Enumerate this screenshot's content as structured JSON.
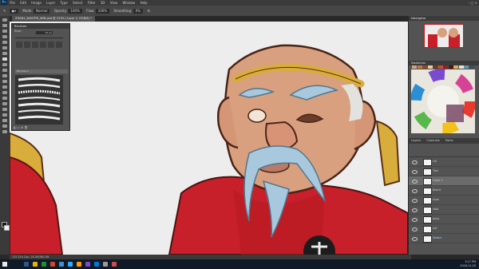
{
  "menubar": {
    "logo": "Ps",
    "items": [
      "File",
      "Edit",
      "Image",
      "Layer",
      "Type",
      "Select",
      "Filter",
      "3D",
      "View",
      "Window",
      "Help"
    ],
    "window_controls": "–  □  ×"
  },
  "options": {
    "mode_label": "Mode:",
    "mode_value": "Normal",
    "opacity_label": "Opacity:",
    "opacity_value": "100%",
    "flow_label": "Flow:",
    "flow_value": "100%",
    "smoothing_label": "Smoothing:",
    "smoothing_value": "0%"
  },
  "document": {
    "tab_title": "ZHAN1_MASTER_WIN.psd @ 133% (Layer 2, RGB/8) *",
    "status": "133.33%    Doc: 28.3M/360.0M"
  },
  "brushes_panel": {
    "title": "Brushes",
    "size_label": "Size:",
    "size_value": "45 px",
    "group_name": "Brushes 1",
    "footer": "◧  ▭  ⊞  🗑"
  },
  "navigator": {
    "title": "Navigator"
  },
  "swatches": {
    "title": "Swatches",
    "colors": [
      "#d0a383",
      "#b9784e",
      "#8a4c2d",
      "#ebc9a6",
      "#6f3a28",
      "#c94a3a",
      "#9a1d1d",
      "#5a1111",
      "#d7b25e",
      "#e6e2d3",
      "#6f8fa6",
      "#3e4d5e"
    ]
  },
  "layers_panel": {
    "tabs": [
      "Layers",
      "Channels",
      "Paths"
    ],
    "layers": [
      {
        "name": "sid",
        "active": false,
        "blue": false
      },
      {
        "name": "Tips",
        "active": false,
        "blue": false
      },
      {
        "name": "Layer 2",
        "active": true,
        "blue": false
      },
      {
        "name": "Beard",
        "active": false,
        "blue": false
      },
      {
        "name": "eyes",
        "active": false,
        "blue": false
      },
      {
        "name": "stab",
        "active": false,
        "blue": false
      },
      {
        "name": "body",
        "active": false,
        "blue": false
      },
      {
        "name": "hat",
        "active": false,
        "blue": false
      },
      {
        "name": "Sketch",
        "active": false,
        "blue": true
      }
    ]
  },
  "taskbar": {
    "time": "3:17 PM",
    "date": "2018-11-20",
    "icon_colors": [
      "#2b5797",
      "#e8b10b",
      "#1d8f3a",
      "#d24726",
      "#3f8fd1",
      "#31a8ff",
      "#ff9a00",
      "#7a4bd1",
      "#0078d7",
      "#9a9a9a",
      "#cf4a4a"
    ]
  },
  "colors": {
    "accent": "#31a8ff",
    "canvas_bg": "#ededed",
    "robe_red": "#c8202a",
    "skin": "#d8a07e"
  }
}
